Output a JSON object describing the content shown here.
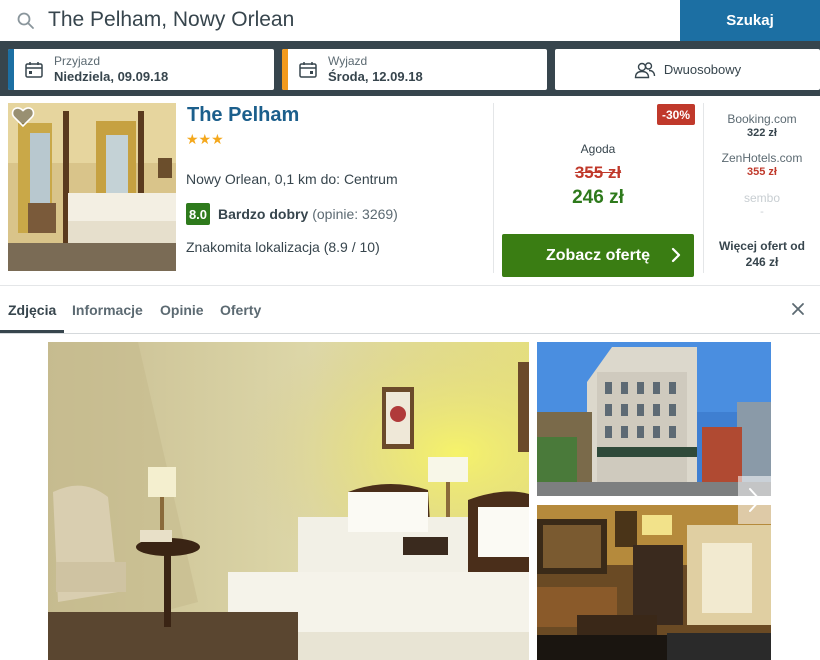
{
  "search": {
    "query": "The Pelham, Nowy Orlean",
    "button_label": "Szukaj"
  },
  "checkin": {
    "label": "Przyjazd",
    "value": "Niedziela, 09.09.18",
    "accent": "#1c6fa3"
  },
  "checkout": {
    "label": "Wyjazd",
    "value": "Środa, 12.09.18",
    "accent": "#f29a1d"
  },
  "guests": {
    "label": "Dwuosobowy"
  },
  "hotel": {
    "name": "The Pelham",
    "stars": "★★★",
    "location": "Nowy Orlean, 0,1 km do: Centrum",
    "rating_score": "8.0",
    "rating_text": "Bardzo dobry",
    "rating_count": "(opinie: 3269)",
    "location_score": "Znakomita lokalizacja (8.9 / 10)"
  },
  "deal": {
    "discount": "-30%",
    "provider": "Agoda",
    "old_price": "355 zł",
    "new_price": "246 zł",
    "button_label": "Zobacz ofertę"
  },
  "alt_offers": [
    {
      "name": "Booking.com",
      "price": "322 zł",
      "price_color": "#37454d"
    },
    {
      "name": "ZenHotels.com",
      "price": "355 zł",
      "price_color": "#c0392b"
    },
    {
      "name": "sembo",
      "price": "-",
      "price_color": "#c8ced2"
    }
  ],
  "more_offers": {
    "line1": "Więcej ofert od",
    "line2": "246 zł"
  },
  "tabs": [
    {
      "label": "Zdjęcia",
      "active": true
    },
    {
      "label": "Informacje",
      "active": false
    },
    {
      "label": "Opinie",
      "active": false
    },
    {
      "label": "Oferty",
      "active": false
    }
  ],
  "colors": {
    "header_bg": "#37454d",
    "brand_blue": "#1c6fa3",
    "cta_green": "#3a7d13",
    "price_green": "#2e7a1c",
    "discount_red": "#c0392b",
    "star_orange": "#f4a81d"
  },
  "icons": [
    "search-icon",
    "calendar-icon",
    "guests-icon",
    "heart-icon",
    "chevron-right-icon",
    "close-icon"
  ]
}
